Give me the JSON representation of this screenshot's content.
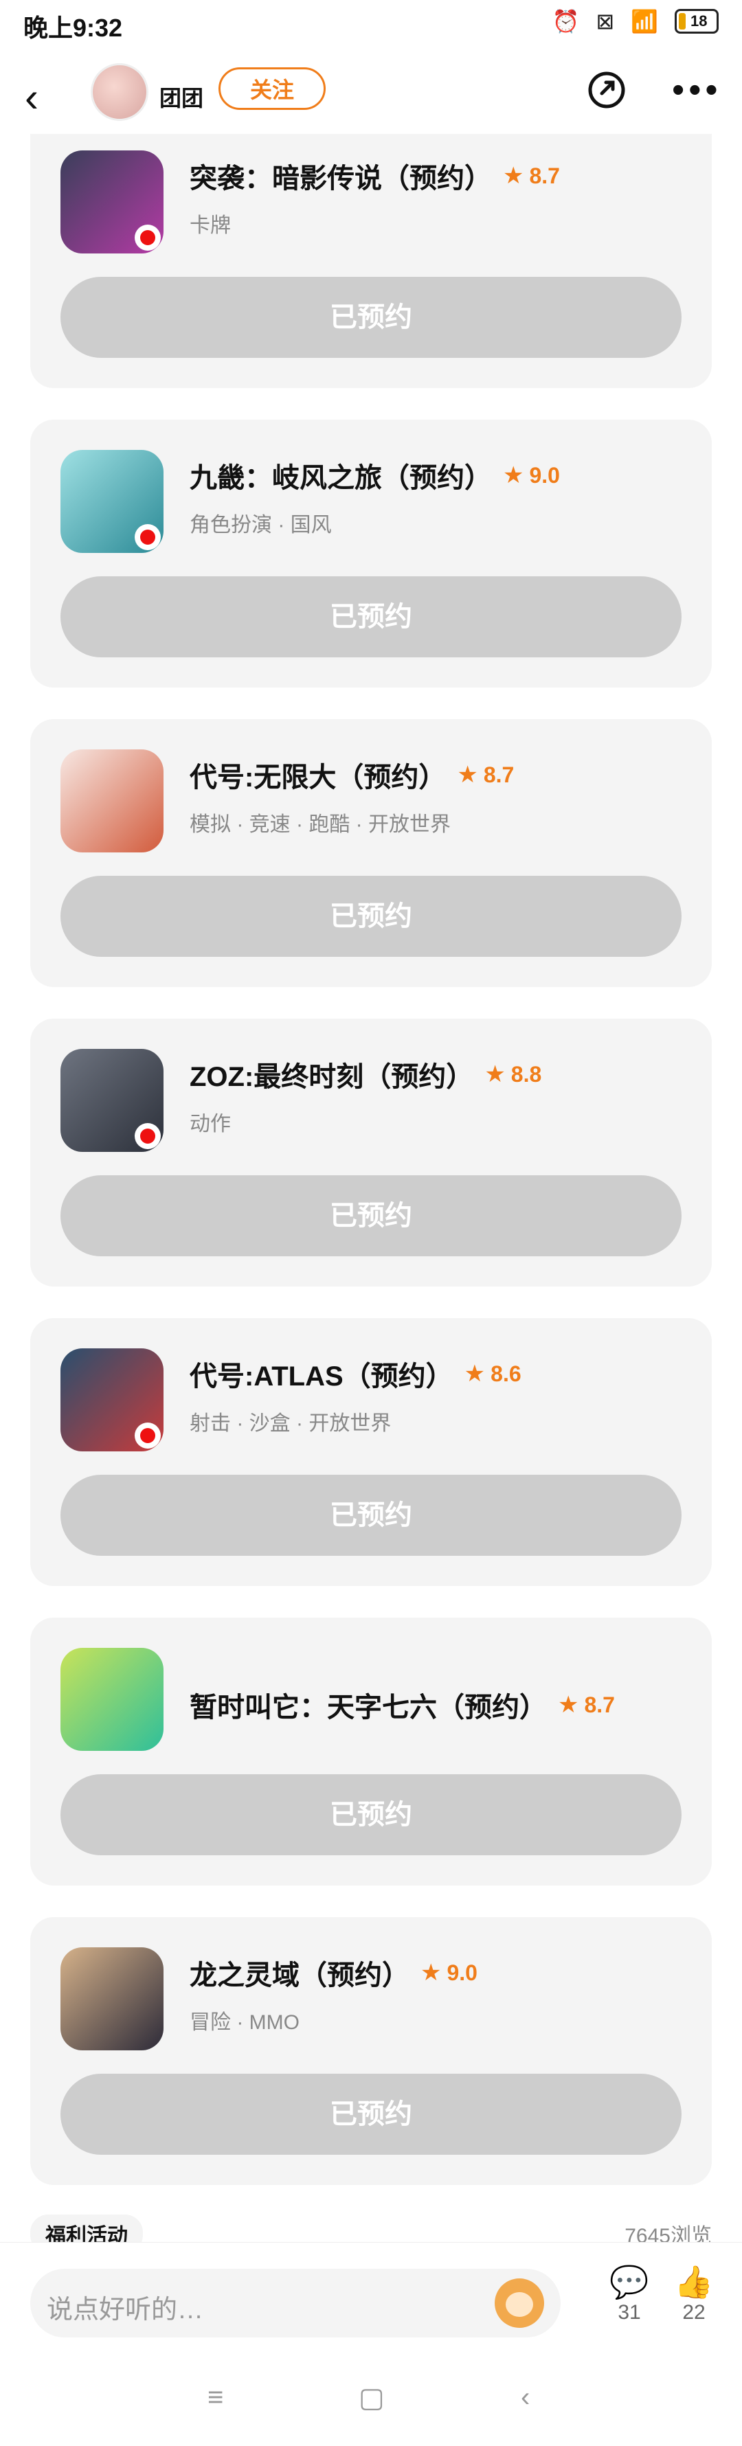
{
  "status": {
    "time": "晚上9:32",
    "battery": "18",
    "icons": [
      "alarm-icon",
      "dnd-icon",
      "wifi-icon",
      "battery-icon"
    ]
  },
  "header": {
    "nickname": "团团",
    "follow": "关注"
  },
  "games": [
    {
      "title": "突袭：暗影传说（预约）",
      "rating": "8.7",
      "tags": "卡牌",
      "button": "已预约",
      "icon_colors": [
        "#3a3f5a",
        "#b43aa5"
      ]
    },
    {
      "title": "九畿：岐风之旅（预约）",
      "rating": "9.0",
      "tags": "角色扮演 · 国风",
      "button": "已预约",
      "icon_colors": [
        "#9fe0e3",
        "#2b8a96"
      ]
    },
    {
      "title": "代号:无限大（预约）",
      "rating": "8.7",
      "tags": "模拟 · 竞速 · 跑酷 · 开放世界",
      "button": "已预约",
      "icon_colors": [
        "#f7e7e2",
        "#d25b3c"
      ]
    },
    {
      "title": "ZOZ:最终时刻（预约）",
      "rating": "8.8",
      "tags": "动作",
      "button": "已预约",
      "icon_colors": [
        "#6e7480",
        "#2c303a"
      ]
    },
    {
      "title": "代号:ATLAS（预约）",
      "rating": "8.6",
      "tags": "射击 · 沙盒 · 开放世界",
      "button": "已预约",
      "icon_colors": [
        "#2a4f6e",
        "#c83b3b"
      ]
    },
    {
      "title": "暂时叫它：天字七六（预约）",
      "rating": "8.7",
      "tags": "",
      "button": "已预约",
      "icon_colors": [
        "#c8e35a",
        "#2fbf9a"
      ]
    },
    {
      "title": "龙之灵域（预约）",
      "rating": "9.0",
      "tags": "冒险 · MMO",
      "button": "已预约",
      "icon_colors": [
        "#d6b28a",
        "#2d2b39"
      ]
    }
  ],
  "peek": {
    "left": "福利活动",
    "right": "7645浏览"
  },
  "bottom": {
    "comment_placeholder": "说点好听的…",
    "comment_count": "31",
    "like_count": "22"
  },
  "colors": {
    "accent": "#f07d1a",
    "button_disabled": "#cdcdcd",
    "card_bg": "#f4f4f4"
  }
}
